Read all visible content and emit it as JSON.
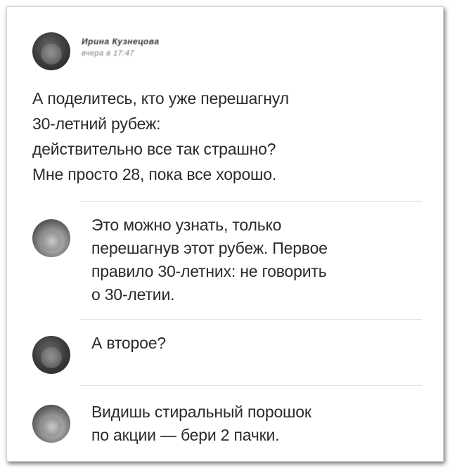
{
  "post": {
    "author_name": "Ирина Кузнецова",
    "author_meta": "вчера в 17:47",
    "text": "А поделитесь, кто уже перешагнул\n30-летний рубеж:\nдействительно все так страшно?\nМне просто 28, пока все хорошо."
  },
  "comments": [
    {
      "text": "Это можно узнать, только\nперешагнув этот рубеж. Первое\nправило 30-летних: не говорить\nо 30-летии."
    },
    {
      "text": "А второе?"
    },
    {
      "text": "Видишь стиральный порошок\nпо акции — бери 2 пачки."
    }
  ]
}
